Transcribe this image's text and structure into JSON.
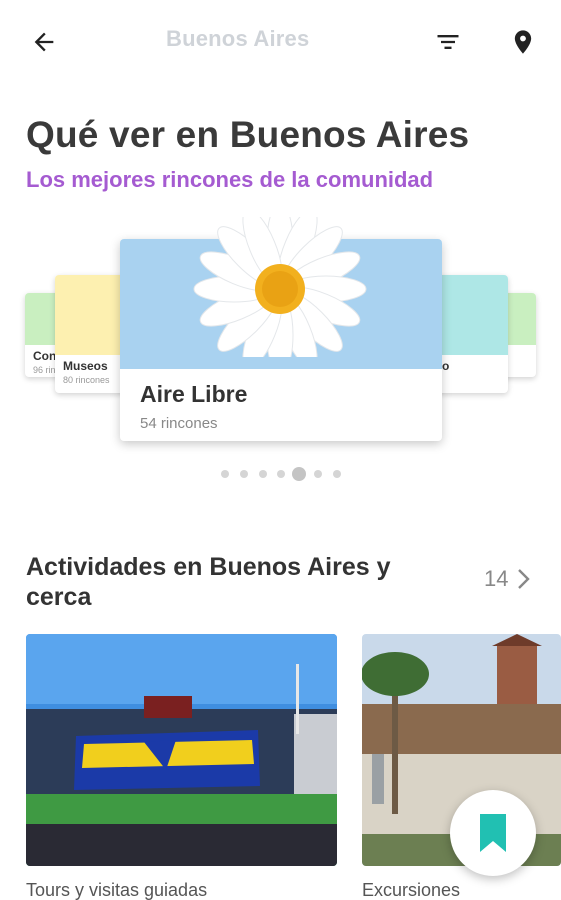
{
  "topbar": {
    "title": "Buenos Aires ",
    "back_icon": "arrow-left-icon",
    "filter_icon": "filter-icon",
    "map_icon": "map-pin-icon"
  },
  "header": {
    "title": "Qué ver en Buenos Aires",
    "subtitle": "Los mejores rincones de la comunidad",
    "subtitle_color": "#a55bd1"
  },
  "carousel": {
    "cards": [
      {
        "label": "Con",
        "sub": "96 rin",
        "color": "#c9efc0"
      },
      {
        "label": "Museos",
        "sub": "80 rincones",
        "color": "#fdf0b0"
      },
      {
        "label": "Aire Libre",
        "sub": "54 rincones",
        "color": "#a9d2f0"
      },
      {
        "label": "o",
        "sub": "",
        "color": "#aee7e6"
      },
      {
        "label": "",
        "sub": "",
        "color": "#c9efc0"
      }
    ],
    "dot_count": 7,
    "active_dot": 4
  },
  "activities": {
    "title": "Actividades en Buenos Aires y cerca",
    "count": "14",
    "items": [
      {
        "label": "Tours y visitas guiadas"
      },
      {
        "label": "Excursiones"
      }
    ]
  },
  "fab": {
    "icon": "bookmark-icon",
    "color": "#21c0b2"
  }
}
